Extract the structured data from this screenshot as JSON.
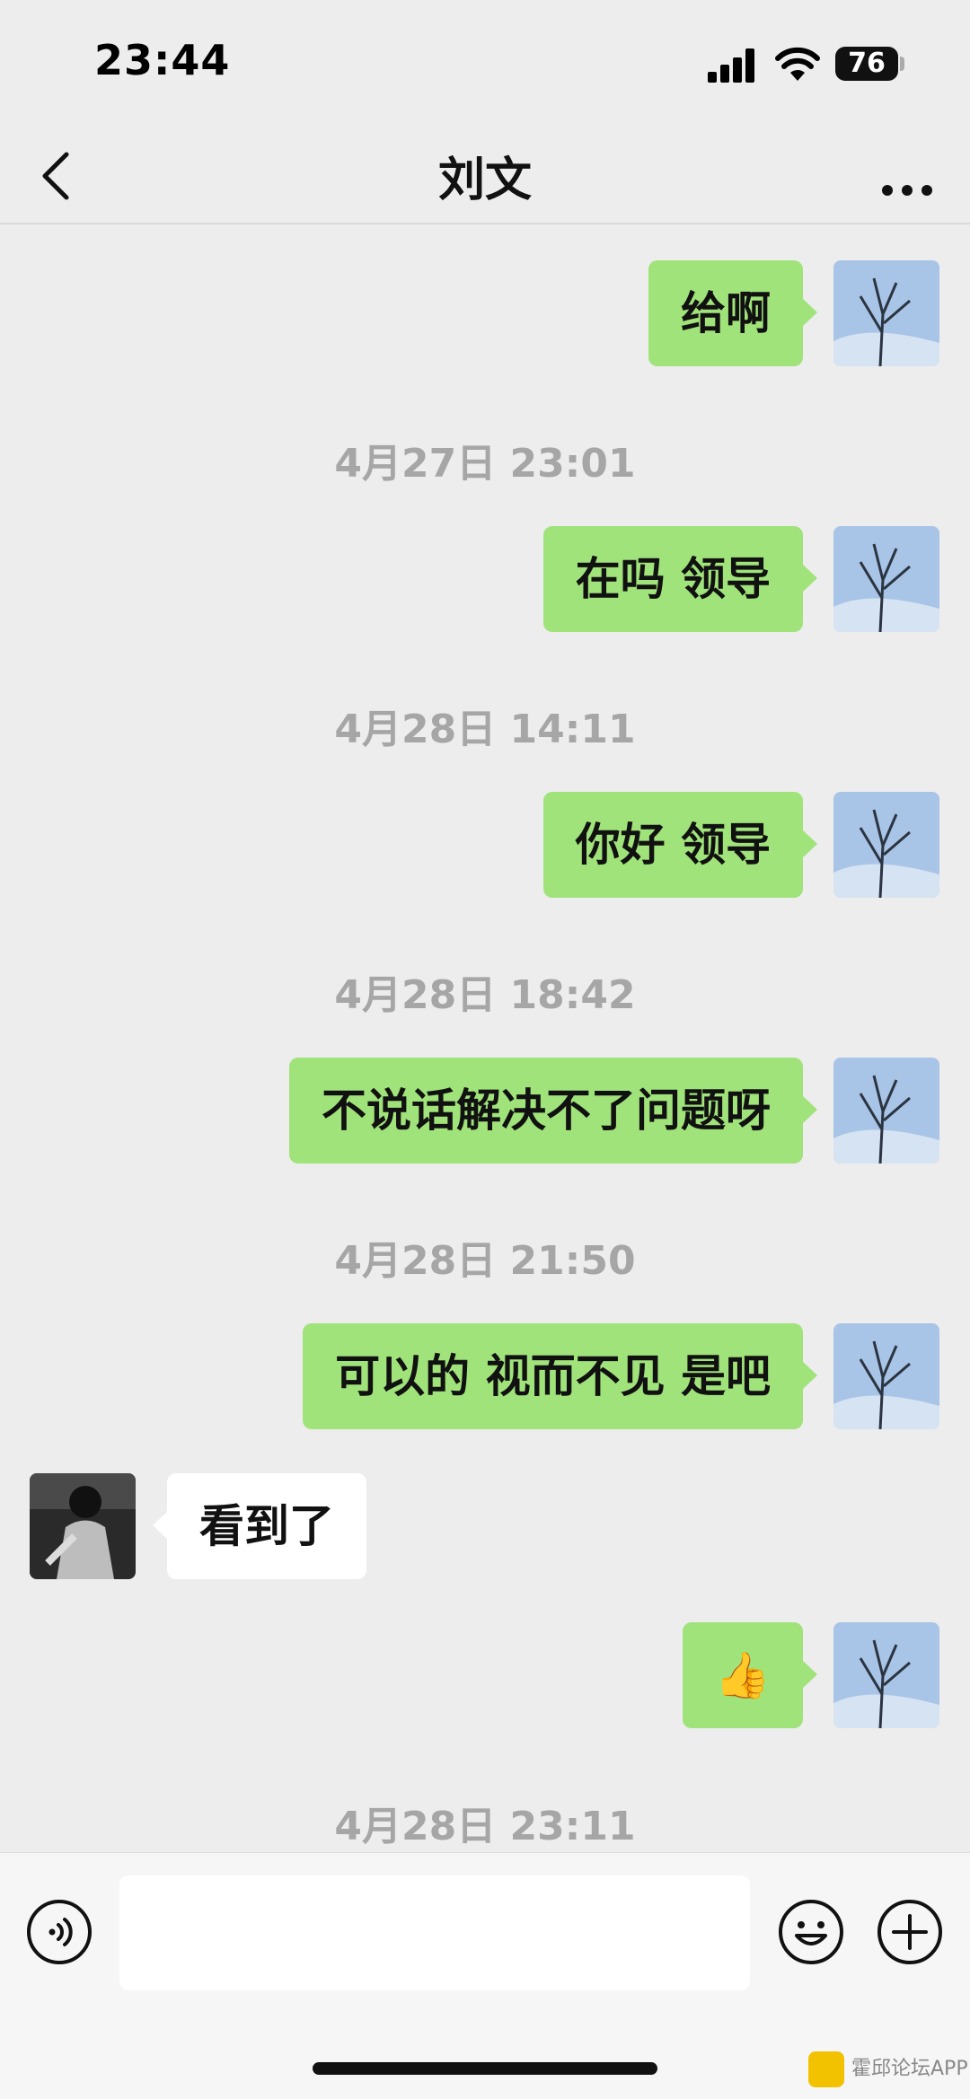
{
  "status_bar": {
    "time": "23:44",
    "battery": "76"
  },
  "header": {
    "title": "刘文"
  },
  "messages": [
    {
      "type": "msg",
      "side": "me",
      "text": "给啊"
    },
    {
      "type": "time",
      "text": "4月27日 23:01"
    },
    {
      "type": "msg",
      "side": "me",
      "text": "在吗 领导"
    },
    {
      "type": "time",
      "text": "4月28日 14:11"
    },
    {
      "type": "msg",
      "side": "me",
      "text": "你好 领导"
    },
    {
      "type": "time",
      "text": "4月28日 18:42"
    },
    {
      "type": "msg",
      "side": "me",
      "text": "不说话解决不了问题呀"
    },
    {
      "type": "time",
      "text": "4月28日 21:50"
    },
    {
      "type": "msg",
      "side": "me",
      "text": "可以的 视而不见 是吧"
    },
    {
      "type": "msg",
      "side": "them",
      "text": "看到了"
    },
    {
      "type": "msg",
      "side": "me",
      "text": "👍"
    },
    {
      "type": "time",
      "text": "4月28日 23:11"
    }
  ],
  "input": {
    "value": "",
    "placeholder": ""
  },
  "watermark": {
    "text": "霍邱论坛APP"
  },
  "colors": {
    "sent_bubble": "#a0e37a",
    "received_bubble": "#ffffff",
    "background": "#ededed"
  }
}
